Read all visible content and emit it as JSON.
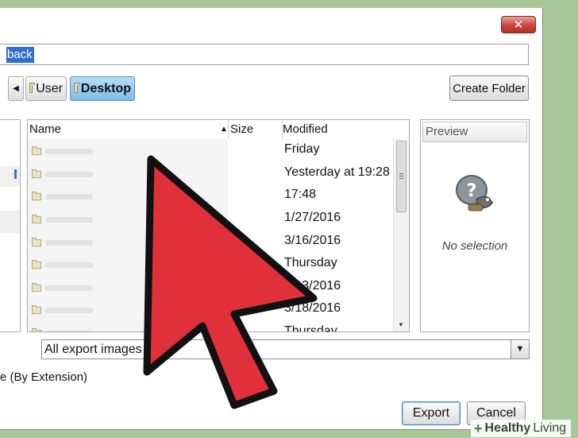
{
  "window": {
    "close_label": "✕"
  },
  "name_field": {
    "value": "back"
  },
  "path": {
    "back_arrow": "◀",
    "segments": [
      "User",
      "Desktop"
    ]
  },
  "toolbar": {
    "create_folder_label": "Create Folder"
  },
  "file_list": {
    "columns": {
      "name": "Name",
      "size": "Size",
      "modified": "Modified"
    },
    "sort_indicator": "▲",
    "rows": [
      {
        "modified": "Friday"
      },
      {
        "modified": "Yesterday at 19:28"
      },
      {
        "modified": "17:48"
      },
      {
        "modified": "1/27/2016"
      },
      {
        "modified": "3/16/2016"
      },
      {
        "modified": "Thursday"
      },
      {
        "modified": "3/13/2016"
      },
      {
        "modified": "3/18/2016"
      },
      {
        "modified": "Thursday"
      }
    ]
  },
  "preview": {
    "label": "Preview",
    "empty_text": "No selection",
    "icon": "gimp-wilber-question-icon"
  },
  "filter": {
    "selected": "All export images",
    "dropdown_icon": "▼"
  },
  "file_type": {
    "label": "e (By Extension)"
  },
  "buttons": {
    "export_label": "Export",
    "cancel_label": "Cancel"
  },
  "overlay": {
    "arrow_color": "#e0303a",
    "icon": "red-pointer-arrow"
  },
  "watermark": {
    "plus": "+",
    "brand_bold": "Healthy",
    "brand_rest": " Living"
  }
}
